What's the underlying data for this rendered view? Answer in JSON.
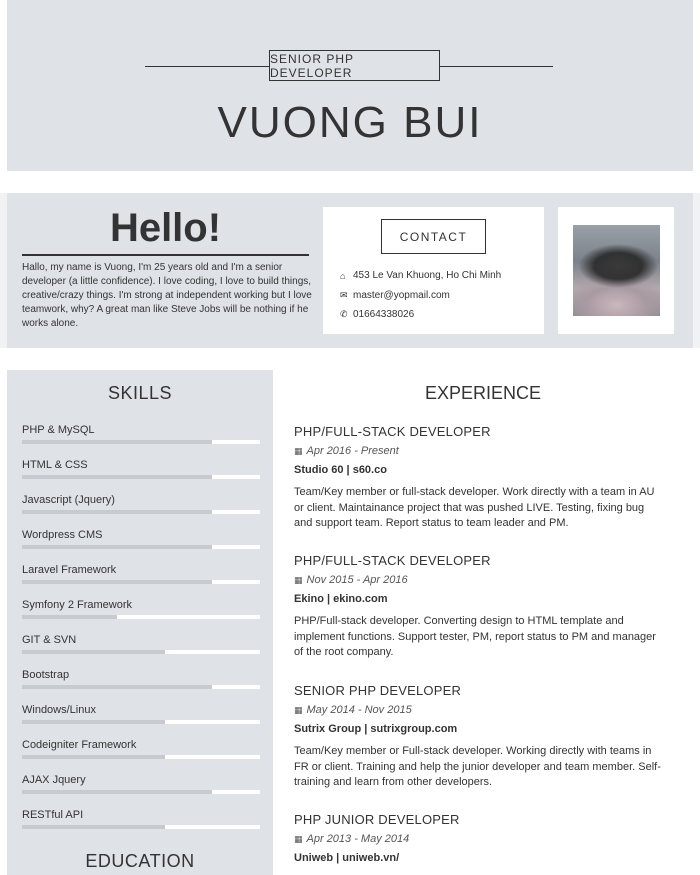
{
  "header": {
    "subtitle": "SENIOR PHP DEVELOPER",
    "name": "VUONG BUI"
  },
  "intro": {
    "heading": "Hello!",
    "text": "Hallo, my name is Vuong, I'm 25 years old and I'm a senior developer (a little confidence). I love coding, I love to build things, creative/crazy things. I'm strong at independent working but I love teamwork, why? A great man like Steve Jobs will be nothing if he works alone."
  },
  "contact": {
    "button_label": "CONTACT",
    "address": "453 Le Van Khuong, Ho Chi Minh",
    "email": "master@yopmail.com",
    "phone": "01664338026",
    "icons": [
      "home-icon",
      "envelope-icon",
      "phone-icon"
    ]
  },
  "skills": {
    "title": "SKILLS",
    "items": [
      {
        "name": "PHP & MySQL",
        "level": 0.8
      },
      {
        "name": "HTML & CSS",
        "level": 0.8
      },
      {
        "name": "Javascript (Jquery)",
        "level": 0.8
      },
      {
        "name": "Wordpress CMS",
        "level": 0.8
      },
      {
        "name": "Laravel Framework",
        "level": 0.8
      },
      {
        "name": "Symfony 2 Framework",
        "level": 0.4
      },
      {
        "name": "GIT & SVN",
        "level": 0.6
      },
      {
        "name": "Bootstrap",
        "level": 0.8
      },
      {
        "name": "Windows/Linux",
        "level": 0.6
      },
      {
        "name": "Codeigniter Framework",
        "level": 0.6
      },
      {
        "name": "AJAX Jquery",
        "level": 0.8
      },
      {
        "name": "RESTful API",
        "level": 0.6
      }
    ]
  },
  "education": {
    "title": "EDUCATION"
  },
  "experience": {
    "title": "EXPERIENCE",
    "jobs": [
      {
        "title": "PHP/FULL-STACK DEVELOPER",
        "date": "Apr 2016 - Present",
        "company": "Studio 60 | s60.co",
        "description": "Team/Key member or full-stack developer. Work directly with a team in AU or client. Maintainance project that was pushed LIVE. Testing, fixing bug and support team. Report status to team leader and PM."
      },
      {
        "title": "PHP/FULL-STACK DEVELOPER",
        "date": "Nov 2015 - Apr 2016",
        "company": "Ekino | ekino.com",
        "description": "PHP/Full-stack developer. Converting design to HTML template and implement functions. Support tester, PM, report status to PM and manager of the root company."
      },
      {
        "title": "SENIOR PHP DEVELOPER",
        "date": "May 2014 - Nov 2015",
        "company": "Sutrix Group | sutrixgroup.com",
        "description": "Team/Key member or Full-stack developer. Working directly with teams in FR or client. Training and help the junior developer and team member. Self-training and learn from other developers."
      },
      {
        "title": "PHP JUNIOR DEVELOPER",
        "date": "Apr 2013 - May 2014",
        "company": "Uniweb | uniweb.vn/",
        "description": ""
      }
    ]
  },
  "colors": {
    "panel": "#dfe2e7",
    "text": "#333333",
    "bar_fill": "#c7cacf"
  }
}
